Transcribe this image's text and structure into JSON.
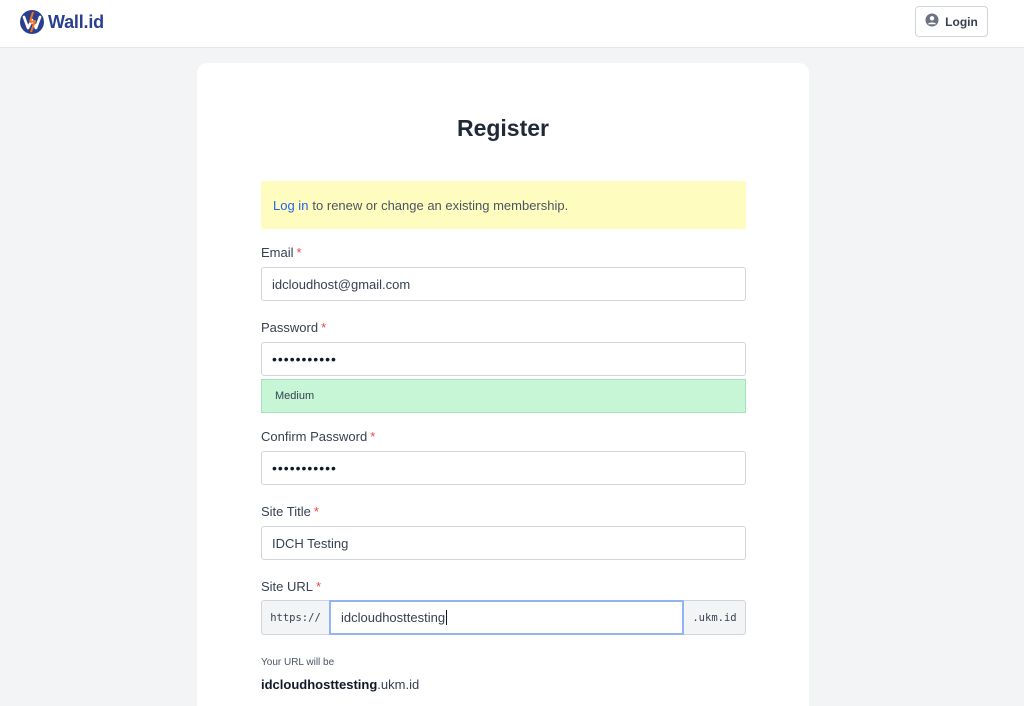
{
  "header": {
    "brand_name": "Wall.id",
    "logo_icon": "wall-id-logo",
    "login_label": "Login",
    "login_icon": "user-circle-icon"
  },
  "form": {
    "title": "Register",
    "notice": {
      "link_text": "Log in",
      "text": "to renew or change an existing membership."
    },
    "email": {
      "label": "Email",
      "required": "*",
      "value": "idcloudhost@gmail.com"
    },
    "password": {
      "label": "Password",
      "required": "*",
      "value": "•••••••••••",
      "strength": "Medium"
    },
    "confirm_password": {
      "label": "Confirm Password",
      "required": "*",
      "value": "•••••••••••"
    },
    "site_title": {
      "label": "Site Title",
      "required": "*",
      "value": "IDCH Testing"
    },
    "site_url": {
      "label": "Site URL",
      "required": "*",
      "prefix": "https://",
      "value": "idcloudhosttesting",
      "suffix": ".ukm.id",
      "help": "Your URL will be",
      "preview_bold": "idcloudhosttesting",
      "preview_rest": ".ukm.id"
    }
  },
  "colors": {
    "brand": "#2b3f8f",
    "accent": "#2563eb",
    "required": "#ef4444",
    "notice_bg": "#fefcbf",
    "strength_medium_bg": "#c6f6d5"
  }
}
